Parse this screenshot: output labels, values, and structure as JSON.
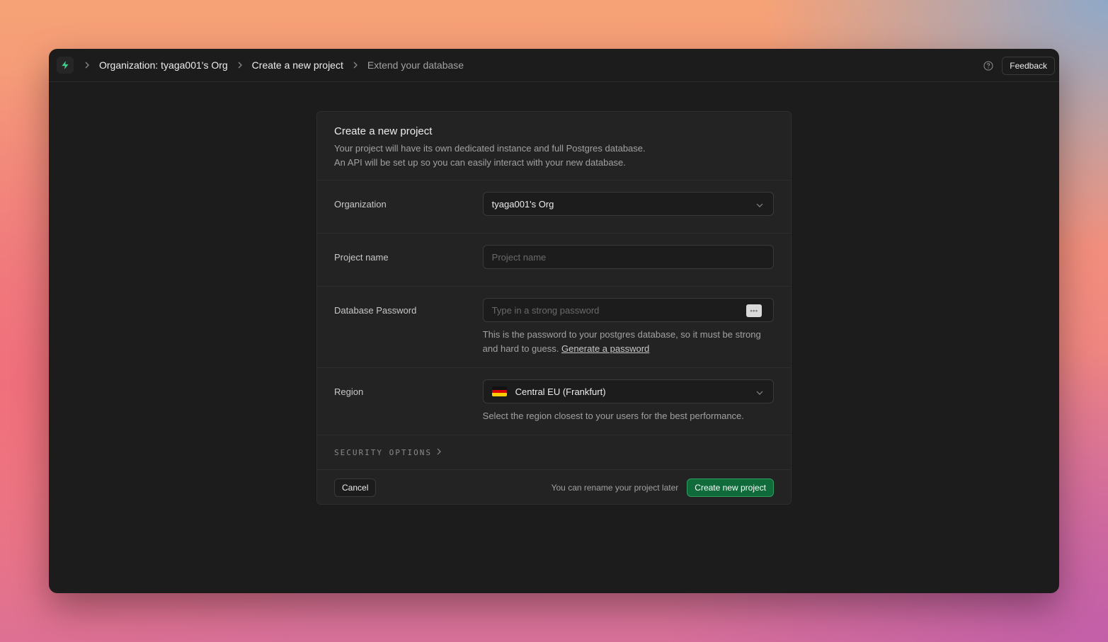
{
  "breadcrumb": {
    "org": "Organization: tyaga001's Org",
    "step": "Create a new project",
    "current": "Extend your database"
  },
  "topbar": {
    "feedback_label": "Feedback"
  },
  "card": {
    "title": "Create a new project",
    "desc_line1": "Your project will have its own dedicated instance and full Postgres database.",
    "desc_line2": "An API will be set up so you can easily interact with your new database."
  },
  "form": {
    "organization": {
      "label": "Organization",
      "value": "tyaga001's Org"
    },
    "project_name": {
      "label": "Project name",
      "placeholder": "Project name",
      "value": ""
    },
    "password": {
      "label": "Database Password",
      "placeholder": "Type in a strong password",
      "help": "This is the password to your postgres database, so it must be strong and hard to guess.",
      "generate_link": "Generate a password"
    },
    "region": {
      "label": "Region",
      "value": "Central EU (Frankfurt)",
      "help": "Select the region closest to your users for the best performance."
    },
    "security_options": "SECURITY OPTIONS"
  },
  "footer": {
    "cancel_label": "Cancel",
    "note": "You can rename your project later",
    "create_label": "Create new project"
  },
  "colors": {
    "accent": "#0f6b3a",
    "accent_border": "#2f9b5e",
    "logo": "#3ecf8e"
  }
}
